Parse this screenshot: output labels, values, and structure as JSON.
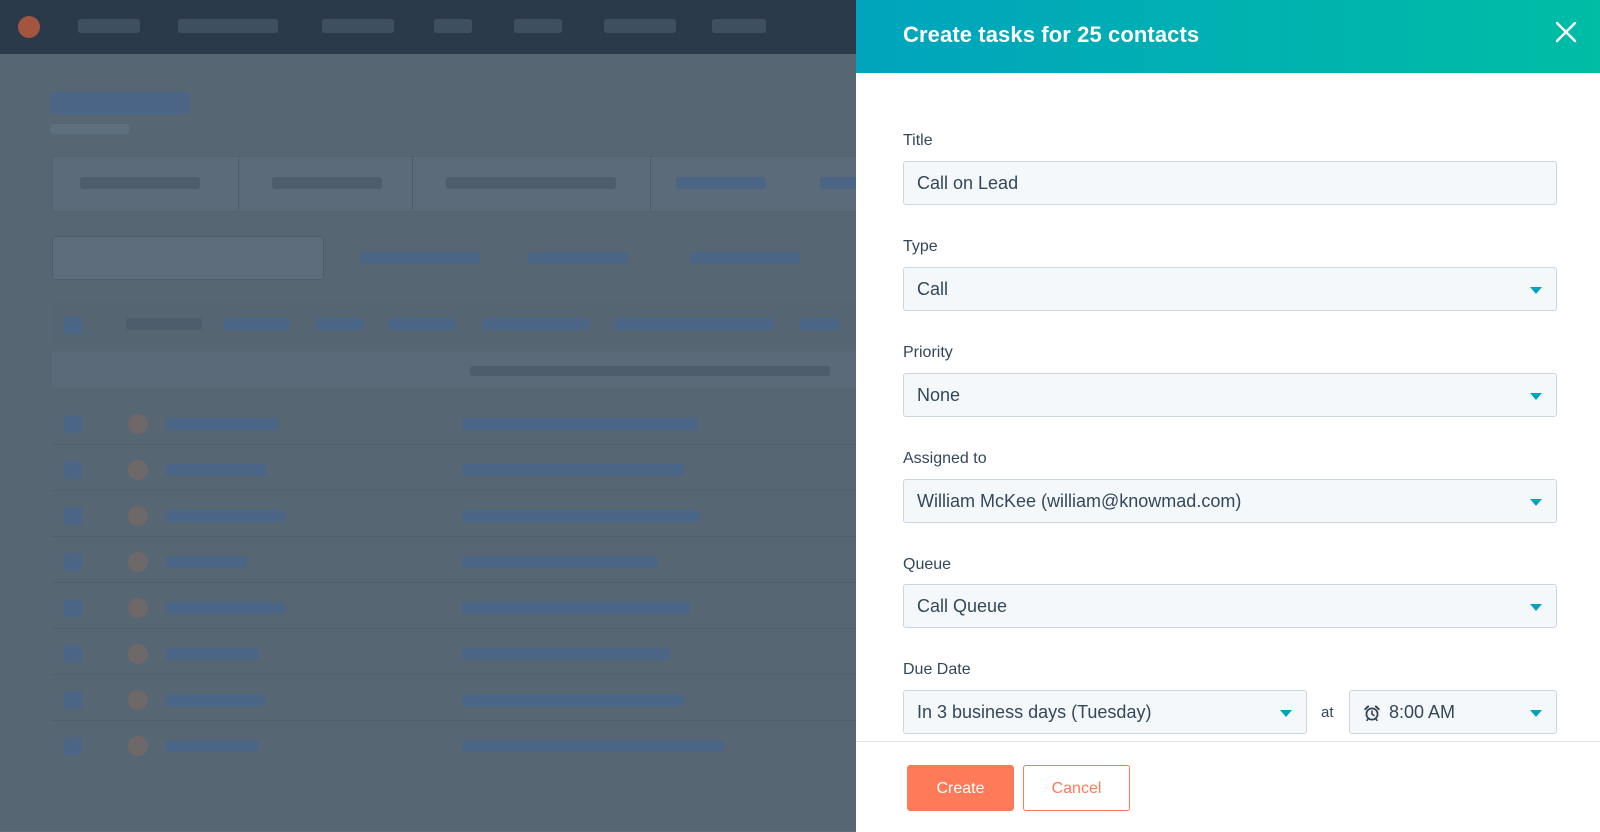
{
  "panel": {
    "title": "Create tasks for 25 contacts",
    "close_icon": "close-icon",
    "accent_gradient": [
      "#00a4bd",
      "#00bda5"
    ]
  },
  "form": {
    "title": {
      "label": "Title",
      "value": "Call on Lead"
    },
    "type": {
      "label": "Type",
      "value": "Call"
    },
    "priority": {
      "label": "Priority",
      "value": "None"
    },
    "assigned_to": {
      "label": "Assigned to",
      "value": "William McKee (william@knowmad.com)"
    },
    "queue": {
      "label": "Queue",
      "value": "Call Queue"
    },
    "due_date": {
      "label": "Due Date",
      "date_value": "In 3 business days (Tuesday)",
      "at_label": "at",
      "time_icon": "alarm-clock-icon",
      "time_value": "8:00 AM"
    }
  },
  "footer": {
    "create_label": "Create",
    "cancel_label": "Cancel",
    "primary_color": "#ff7a59"
  }
}
